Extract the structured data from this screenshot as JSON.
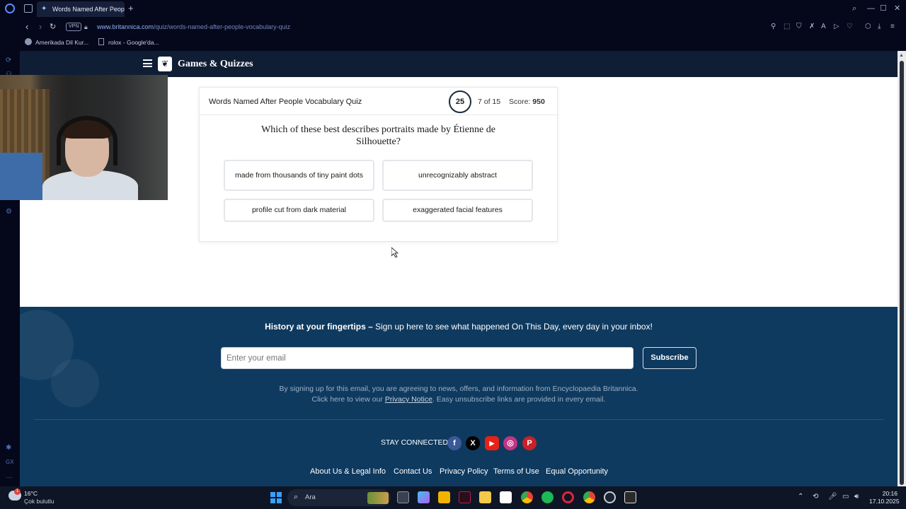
{
  "browser": {
    "tab_title": "Words Named After People Vocabulary Quiz",
    "new_tab_symbol": "+",
    "vpn_label": "VPN",
    "url_domain": "www.britannica.com",
    "url_path": "/quiz/words-named-after-people-vocabulary-quiz",
    "bookmarks": [
      {
        "label": "Amerikada Dil Kur..."
      },
      {
        "label": "rolox - Google'da..."
      }
    ]
  },
  "site": {
    "name": "Games & Quizzes"
  },
  "quiz": {
    "title": "Words Named After People Vocabulary Quiz",
    "timer": "25",
    "progress": "7 of 15",
    "score_label": "Score:",
    "score_value": "950",
    "question": "Which of these best describes portraits made by Étienne de Silhouette?",
    "answers": [
      {
        "label": "made from thousands of tiny paint dots"
      },
      {
        "label": "unrecognizably abstract"
      },
      {
        "label": "profile cut from dark material"
      },
      {
        "label": "exaggerated facial features"
      }
    ]
  },
  "newsletter": {
    "headline_bold": "History at your fingertips –",
    "headline_rest": " Sign up here to see what happened On This Day, every day in your inbox!",
    "email_placeholder": "Enter your email",
    "subscribe_label": "Subscribe",
    "legal_line1": "By signing up for this email, you are agreeing to news, offers, and information from Encyclopaedia Britannica.",
    "legal_line2_pre": "Click here to view our ",
    "legal_link": "Privacy Notice",
    "legal_line2_post": ". Easy unsubscribe links are provided in every email."
  },
  "footer": {
    "stay_connected": "STAY CONNECTED",
    "social": [
      {
        "icon": "facebook-icon",
        "glyph": "f",
        "color": "#3b5998"
      },
      {
        "icon": "x-icon",
        "glyph": "X",
        "color": "#000000"
      },
      {
        "icon": "youtube-icon",
        "glyph": "▶",
        "color": "#e62117"
      },
      {
        "icon": "instagram-icon",
        "glyph": "◎",
        "color": "#c13584"
      },
      {
        "icon": "pinterest-icon",
        "glyph": "P",
        "color": "#cb2027"
      }
    ],
    "links": [
      {
        "label": "About Us & Legal Info"
      },
      {
        "label": "Contact Us"
      },
      {
        "label": "Privacy Policy"
      },
      {
        "label": "Terms of Use"
      },
      {
        "label": "Equal Opportunity"
      }
    ]
  },
  "taskbar": {
    "temperature": "16°C",
    "condition": "Çok bulutlu",
    "search_placeholder": "Ara",
    "time": "20:16",
    "date": "17.10.2025"
  },
  "colors": {
    "header_bg": "#0f1e34",
    "footer_bg": "#0f3a5f",
    "browser_bg": "#05081a"
  }
}
